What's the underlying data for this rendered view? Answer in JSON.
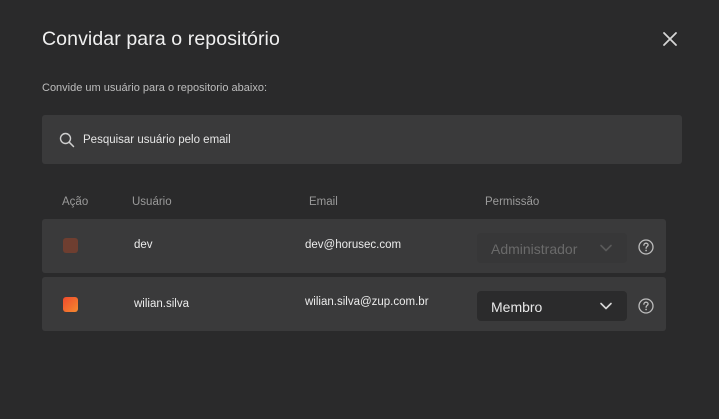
{
  "dialog": {
    "title": "Convidar para o repositório",
    "subtitle": "Convide um usuário para o repositorio abaixo:"
  },
  "search": {
    "placeholder": "Pesquisar usuário pelo email",
    "value": ""
  },
  "table": {
    "columns": [
      "Ação",
      "Usuário",
      "Email",
      "Permissão"
    ],
    "rows": [
      {
        "user": "dev",
        "email": "dev@horusec.com",
        "permission": "Administrador",
        "checked": false,
        "disabled": true
      },
      {
        "user": "wilian.silva",
        "email": "wilian.silva@zup.com.br",
        "permission": "Membro",
        "checked": true,
        "disabled": false
      }
    ]
  },
  "icons": {
    "close": "close-icon",
    "search": "search-icon",
    "chevron": "chevron-down-icon",
    "help": "help-icon"
  },
  "colors": {
    "background": "#2a2a2b",
    "surface": "#3a3a3b",
    "select_bg": "#2b2b2c",
    "accent_start": "#ef4a2d",
    "accent_end": "#f58a2f",
    "disabled_accent": "#6e3e30"
  }
}
